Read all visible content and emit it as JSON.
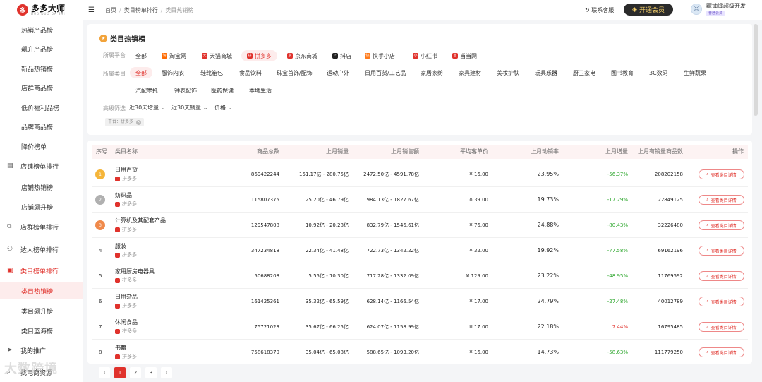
{
  "brand": {
    "name": "多多大师",
    "sub": "DUO DUO DA SHI",
    "logo_char": "多"
  },
  "sidebar": {
    "items": [
      {
        "label": "热销产品榜",
        "type": "sub"
      },
      {
        "label": "飙升产品榜",
        "type": "sub"
      },
      {
        "label": "新品热销榜",
        "type": "sub"
      },
      {
        "label": "店群商品榜",
        "type": "sub"
      },
      {
        "label": "低价福利品榜",
        "type": "sub"
      },
      {
        "label": "品牌商品榜",
        "type": "sub"
      },
      {
        "label": "降价榜单",
        "type": "sub"
      },
      {
        "label": "店铺榜单排行",
        "type": "group",
        "icon": "store-icon"
      },
      {
        "label": "店铺热销榜",
        "type": "sub"
      },
      {
        "label": "店铺飙升榜",
        "type": "sub"
      },
      {
        "label": "店群榜单排行",
        "type": "group",
        "icon": "copy-icon"
      },
      {
        "label": "达人榜单排行",
        "type": "group",
        "icon": "people-icon"
      },
      {
        "label": "类目榜单排行",
        "type": "group",
        "icon": "cart-icon"
      },
      {
        "label": "类目热销榜",
        "type": "sub"
      },
      {
        "label": "类目飙升榜",
        "type": "sub"
      },
      {
        "label": "类目蓝海榜",
        "type": "sub"
      },
      {
        "label": "我的推广",
        "type": "group",
        "icon": "send-icon"
      },
      {
        "label": "找电商资源",
        "type": "group",
        "icon": "search-icon"
      }
    ]
  },
  "topbar": {
    "crumbs": [
      "首页",
      "类目榜单排行",
      "类目热销榜"
    ],
    "service": "联系客服",
    "vip": "开通会员",
    "user_name": "藏铀镭超级开发",
    "user_badge": "普通会员"
  },
  "filters": {
    "title": "类目热销榜",
    "platform_label": "所属平台",
    "platforms": [
      {
        "label": "全部",
        "color": ""
      },
      {
        "label": "淘宝网",
        "color": "#ff6a00"
      },
      {
        "label": "天猫商城",
        "color": "#e0322c"
      },
      {
        "label": "拼多多",
        "color": "#e0322c"
      },
      {
        "label": "京东商城",
        "color": "#e0322c"
      },
      {
        "label": "抖店",
        "color": "#222222"
      },
      {
        "label": "快手小店",
        "color": "#ff7a1a"
      },
      {
        "label": "小红书",
        "color": "#e0322c"
      },
      {
        "label": "当当网",
        "color": "#e0322c"
      }
    ],
    "category_label": "所属类目",
    "categories_row1": [
      "全部",
      "服饰内衣",
      "鞋靴箱包",
      "食品饮料",
      "珠宝首饰/配饰",
      "运动户外",
      "日用百货/工艺品",
      "家居家纺",
      "家具建材",
      "美妆护肤",
      "玩具乐器",
      "厨卫家电",
      "图书教育",
      "3C数码",
      "生鲜蔬果"
    ],
    "categories_row2": [
      "汽配摩托",
      "钟表配饰",
      "医药保健",
      "本地生活"
    ],
    "advanced_label": "高级筛选",
    "dropdowns": [
      "近30天增量",
      "近30天销量",
      "价格"
    ],
    "active_tag": "平台：拼多多"
  },
  "table": {
    "headers": [
      "序号",
      "类目名称",
      "商品总数",
      "上月销量",
      "上月销售额",
      "平均客单价",
      "上月动销率",
      "上月增量",
      "上月有销量商品数",
      "操作"
    ],
    "action_label": "查看类目详情",
    "rows": [
      {
        "rank": "1",
        "name": "日用百货",
        "platform": "拼多多",
        "total": "869422244",
        "sales": "151.17亿 - 280.75亿",
        "revenue": "2472.50亿 - 4591.78亿",
        "avg": "¥ 16.00",
        "rate": "23.95%",
        "growth": "-56.37%",
        "count": "208202158"
      },
      {
        "rank": "2",
        "name": "纺织品",
        "platform": "拼多多",
        "total": "115807375",
        "sales": "25.20亿 - 46.79亿",
        "revenue": "984.13亿 - 1827.67亿",
        "avg": "¥ 39.00",
        "rate": "19.73%",
        "growth": "-17.29%",
        "count": "22849125"
      },
      {
        "rank": "3",
        "name": "计算机及其配套产品",
        "platform": "拼多多",
        "total": "129547808",
        "sales": "10.92亿 - 20.28亿",
        "revenue": "832.79亿 - 1546.61亿",
        "avg": "¥ 76.00",
        "rate": "24.88%",
        "growth": "-80.43%",
        "count": "32226480"
      },
      {
        "rank": "4",
        "name": "服装",
        "platform": "拼多多",
        "total": "347234818",
        "sales": "22.34亿 - 41.48亿",
        "revenue": "722.73亿 - 1342.22亿",
        "avg": "¥ 32.00",
        "rate": "19.92%",
        "growth": "-77.58%",
        "count": "69162196"
      },
      {
        "rank": "5",
        "name": "家用厨房电器具",
        "platform": "拼多多",
        "total": "50688208",
        "sales": "5.55亿 - 10.30亿",
        "revenue": "717.28亿 - 1332.09亿",
        "avg": "¥ 129.00",
        "rate": "23.22%",
        "growth": "-48.95%",
        "count": "11769592"
      },
      {
        "rank": "6",
        "name": "日用杂品",
        "platform": "拼多多",
        "total": "161425361",
        "sales": "35.32亿 - 65.59亿",
        "revenue": "628.14亿 - 1166.54亿",
        "avg": "¥ 17.00",
        "rate": "24.79%",
        "growth": "-27.48%",
        "count": "40012789"
      },
      {
        "rank": "7",
        "name": "休闲食品",
        "platform": "拼多多",
        "total": "75721023",
        "sales": "35.67亿 - 66.25亿",
        "revenue": "624.07亿 - 1158.99亿",
        "avg": "¥ 17.00",
        "rate": "22.18%",
        "growth": "7.44%",
        "count": "16795485"
      },
      {
        "rank": "8",
        "name": "书籍",
        "platform": "拼多多",
        "total": "758618370",
        "sales": "35.04亿 - 65.08亿",
        "revenue": "588.65亿 - 1093.20亿",
        "avg": "¥ 16.00",
        "rate": "14.73%",
        "growth": "-58.63%",
        "count": "111779250"
      }
    ]
  },
  "pager": {
    "pages": [
      "1",
      "2",
      "3"
    ],
    "prev": "‹",
    "next": "›"
  },
  "watermark": "大数跨境",
  "colors": {
    "accent": "#e0322c",
    "growth_positive": "#e0322c",
    "growth_negative": "#2aa52a"
  }
}
